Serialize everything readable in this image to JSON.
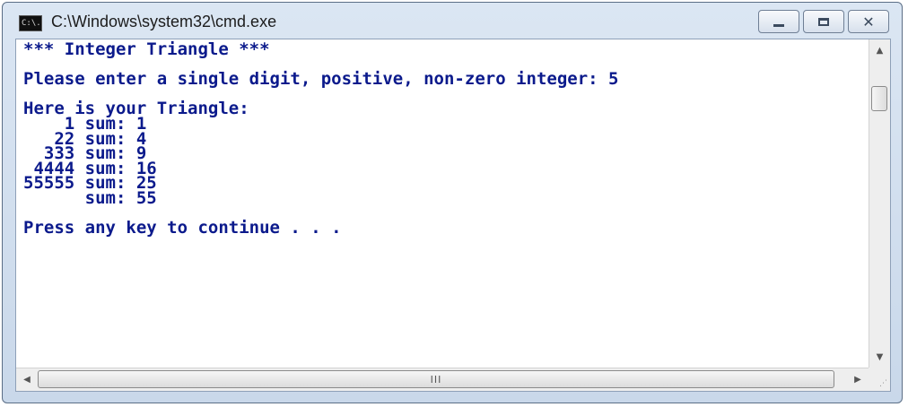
{
  "window": {
    "title": "C:\\Windows\\system32\\cmd.exe",
    "app_icon_text": "C:\\."
  },
  "console": {
    "lines": [
      "*** Integer Triangle ***",
      "",
      "Please enter a single digit, positive, non-zero integer: 5",
      "",
      "Here is your Triangle:",
      "    1 sum: 1",
      "   22 sum: 4",
      "  333 sum: 9",
      " 4444 sum: 16",
      "55555 sum: 25",
      "      sum: 55",
      "",
      "Press any key to continue . . ."
    ]
  },
  "scrollbar": {
    "h_thumb_grip": "III"
  },
  "colors": {
    "console_text": "#0b1a8c",
    "console_background": "#ffffff"
  }
}
